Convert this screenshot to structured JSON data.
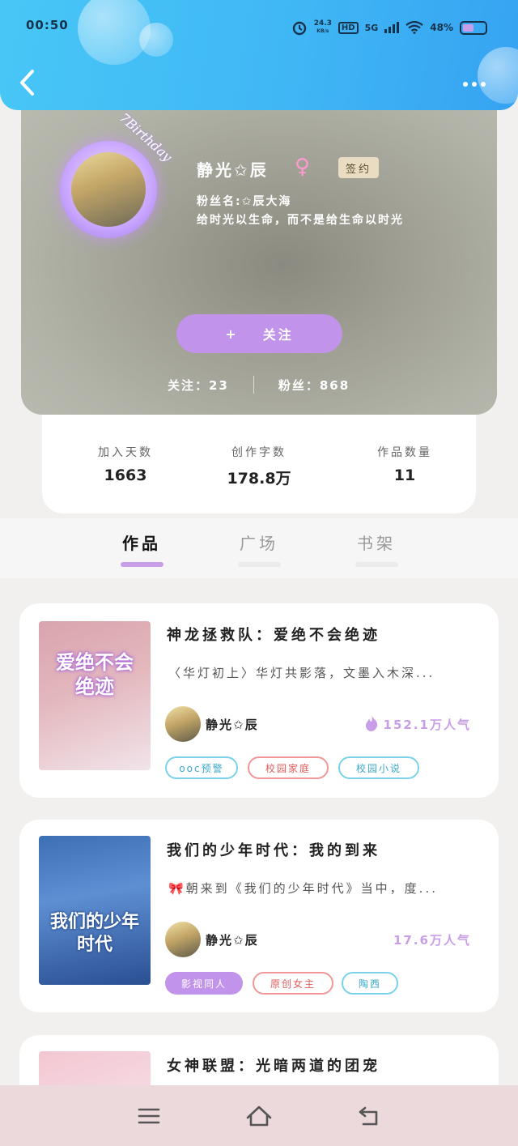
{
  "status_bar": {
    "time": "00:50",
    "net_speed": "24.3",
    "net_unit": "KB/s",
    "hd": "HD",
    "signal": "5G",
    "battery": "48%"
  },
  "profile": {
    "name": "静光✩辰",
    "gender_symbol": "♀",
    "sign_badge": "签约",
    "fan_name": "粉丝名:✩辰大海",
    "motto": "给时光以生命，而不是给生命以时光",
    "avatar_caption": "7Birthday",
    "follow_plus": "+",
    "follow_label": "关注",
    "following_label": "关注：23",
    "fans_label": "粉丝：868"
  },
  "stats": [
    {
      "label": "加入天数",
      "value": "1663"
    },
    {
      "label": "创作字数",
      "value": "178.8万"
    },
    {
      "label": "作品数量",
      "value": "11"
    }
  ],
  "tabs": [
    {
      "label": "作品",
      "active": true
    },
    {
      "label": "广场",
      "active": false
    },
    {
      "label": "书架",
      "active": false
    }
  ],
  "books": [
    {
      "title": "神龙拯救队：爱绝不会绝迹",
      "desc": "〈华灯初上〉华灯共影落，文墨入木深...",
      "author": "静光✩辰",
      "popularity": "152.1万人气",
      "cover_text": "爱绝不会绝迹",
      "tags": [
        "ooc预警",
        "校园家庭",
        "校园小说"
      ]
    },
    {
      "title": "我们的少年时代：我的到来",
      "desc": "🎀朝来到《我们的少年时代》当中，度...",
      "author": "静光✩辰",
      "popularity": "17.6万人气",
      "cover_text": "我们的少年时代",
      "tags": [
        "影视同人",
        "原创女主",
        "陶西"
      ]
    },
    {
      "title": "女神联盟：光暗两道的团宠"
    }
  ],
  "colors": {
    "header_blue": "#40b7f5",
    "accent_purple": "#c293ea",
    "tag_blue": "#79d2ea",
    "tag_red": "#f09797"
  },
  "icons": {
    "back": "back-arrow-icon",
    "more": "more-dots-icon",
    "fire": "fire-icon",
    "nav_menu": "menu-icon",
    "nav_home": "home-icon",
    "nav_back": "back-icon"
  }
}
